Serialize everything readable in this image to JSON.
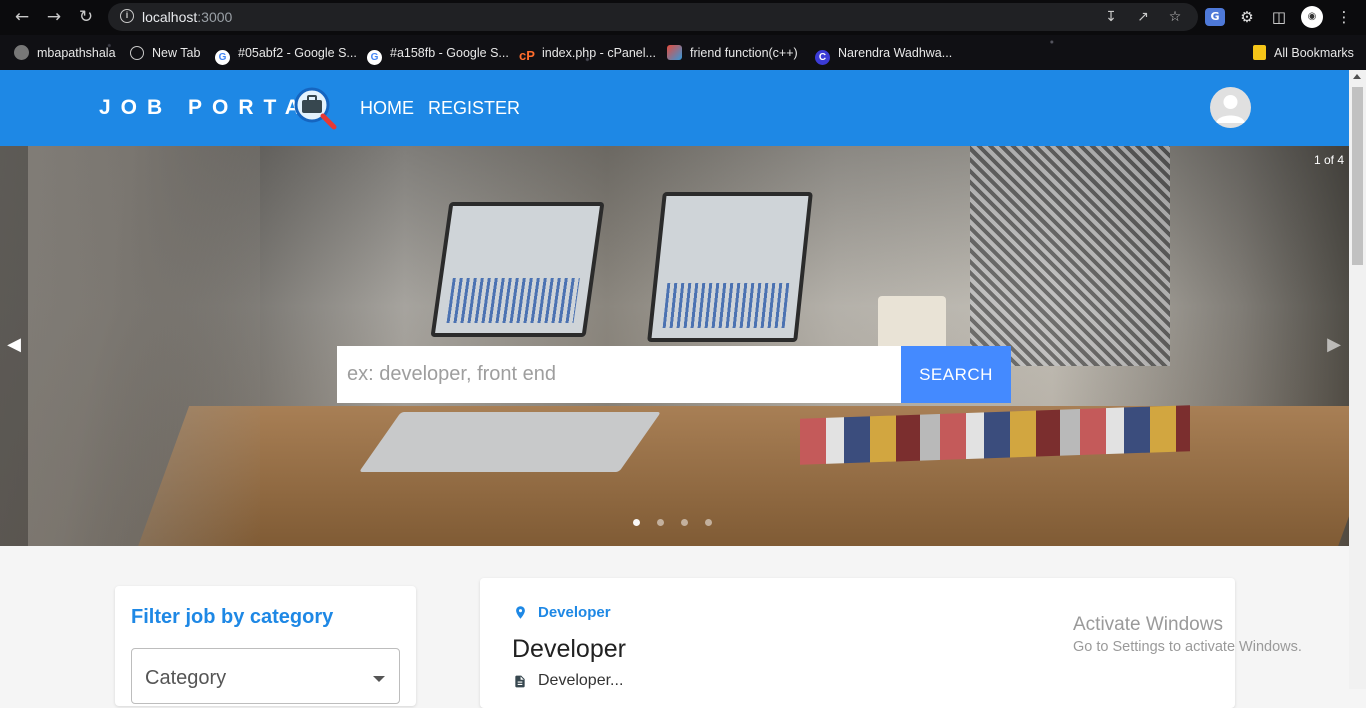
{
  "browser": {
    "url_host": "localhost",
    "url_port": ":3000",
    "bookmarks": [
      {
        "label": "mbapathshala",
        "icon": "mbapathshala-icon"
      },
      {
        "label": "New Tab",
        "icon": "globe-icon"
      },
      {
        "label": "#05abf2 - Google S...",
        "icon": "google-icon"
      },
      {
        "label": "#a158fb - Google S...",
        "icon": "google-icon"
      },
      {
        "label": "index.php - cPanel...",
        "icon": "cpanel-icon"
      },
      {
        "label": "friend function(c++)",
        "icon": "bookmark-favicon-icon"
      },
      {
        "label": "Narendra Wadhwa...",
        "icon": "c-logo-icon"
      }
    ],
    "all_bookmarks": "All Bookmarks"
  },
  "header": {
    "brand": "JOB PORTAL",
    "nav": [
      "HOME",
      "REGISTER"
    ],
    "accent_color": "#1e88e5"
  },
  "hero": {
    "counter": "1 of 4",
    "active_slide": 1,
    "total_slides": 4,
    "search_placeholder": "ex: developer, front end",
    "search_button": "SEARCH",
    "search_button_color": "#448aff"
  },
  "filter": {
    "title": "Filter job by category",
    "select_label": "Category"
  },
  "job": {
    "location": "Developer",
    "title": "Developer",
    "description": "Developer..."
  },
  "watermark": {
    "title": "Activate Windows",
    "subtitle": "Go to Settings to activate Windows."
  }
}
